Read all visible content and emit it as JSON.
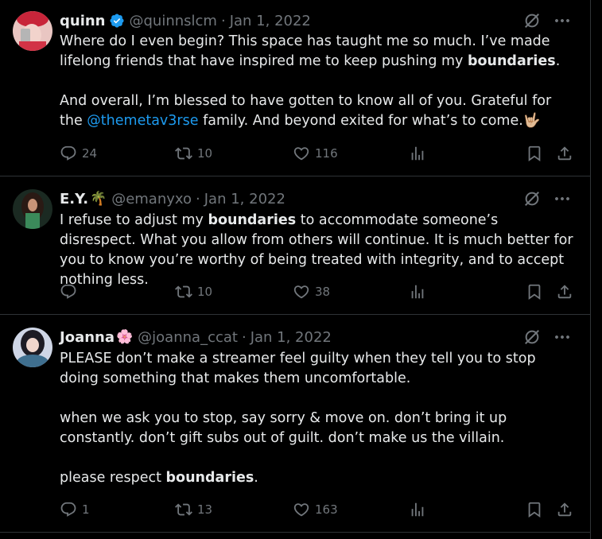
{
  "tweets": [
    {
      "name": "quinn",
      "verified": true,
      "emoji": "",
      "handle": "@quinnslcm",
      "date": "Jan 1, 2022",
      "p1_a": "Where do I even begin? This space has taught me so much. I’ve made lifelong friends that have inspired me to keep pushing my ",
      "p1_b": "boundaries",
      "p1_c": ".",
      "p2_a": "And overall, I’m blessed to have gotten to know all of you. Grateful for the ",
      "p2_link": "@themetav3rse",
      "p2_b": " family. And beyond exited for what’s to come.🤟🏼",
      "replies": "24",
      "reposts": "10",
      "likes": "116"
    },
    {
      "name": "E.Y.",
      "emoji": "🌴",
      "handle": "@emanyxo",
      "date": "Jan 1, 2022",
      "p1_a": "I refuse to adjust my ",
      "p1_b": "boundaries",
      "p1_c": " to accommodate someone’s disrespect. What you allow from others will continue. It is much better for you to know you’re worthy of being treated with integrity, and to accept nothing less.",
      "replies": "",
      "reposts": "10",
      "likes": "38"
    },
    {
      "name": "Joanna",
      "emoji": "🌸",
      "handle": "@joanna_ccat",
      "date": "Jan 1, 2022",
      "p1": "PLEASE don’t make a streamer feel guilty when they tell you to stop doing something that makes them uncomfortable.",
      "p2": "when we ask you to stop, say sorry & move on. don’t bring it up constantly. don’t gift subs out of guilt. don’t make us the villain.",
      "p3_a": "please respect ",
      "p3_b": "boundaries",
      "p3_c": ".",
      "replies": "1",
      "reposts": "13",
      "likes": "163"
    }
  ],
  "icons": {
    "reply": "reply-icon",
    "repost": "repost-icon",
    "like": "like-icon",
    "views": "views-icon",
    "bookmark": "bookmark-icon",
    "share": "share-icon",
    "grok": "grok-icon",
    "more": "more-icon",
    "verified": "verified-badge-icon"
  },
  "colors": {
    "background": "#000000",
    "text": "#e7e9ea",
    "muted": "#71767b",
    "link": "#1d9bf0",
    "border": "#2f3336"
  }
}
